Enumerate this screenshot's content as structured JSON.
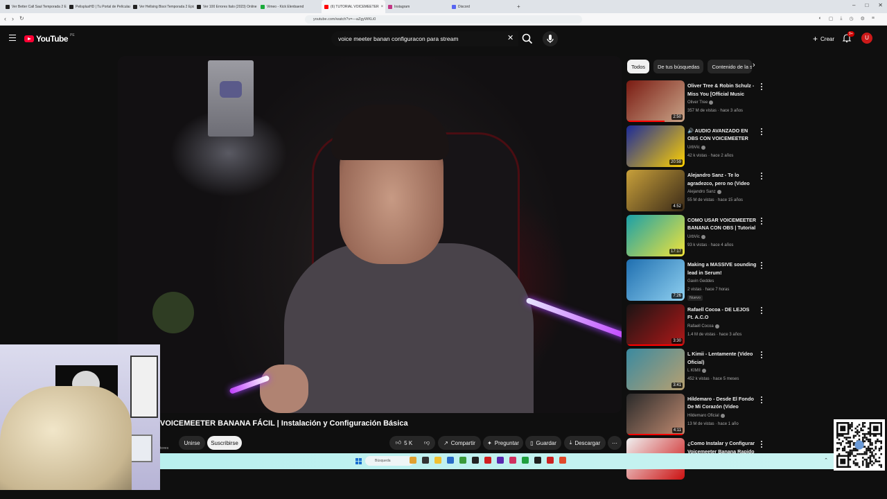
{
  "browser": {
    "tabs": [
      {
        "label": "Ver Better Call Saul Temporada 2 Ep",
        "favicon_color": "#222222",
        "active": false
      },
      {
        "label": "PelisplusHD | Tu Portal de Películas",
        "favicon_color": "#222222",
        "active": false
      },
      {
        "label": "Ver Hellsing Bisoi Temporada 2 Episo",
        "favicon_color": "#222222",
        "active": false
      },
      {
        "label": "Ver 100 Errores Italo (2023) Online",
        "favicon_color": "#222222",
        "active": false
      },
      {
        "label": "Vimeo - Kick Elenbaend",
        "favicon_color": "#1aaa3a",
        "active": false
      },
      {
        "label": "(6) TUTORIAL VOICEMEETER",
        "favicon_color": "#ff0000",
        "active": true
      },
      {
        "label": "Instagram",
        "favicon_color": "#c13584",
        "active": false
      },
      {
        "label": "Discord",
        "favicon_color": "#5865f2",
        "active": false
      }
    ],
    "url": "youtube.com/watch?v=—aZgyWKLi0"
  },
  "masthead": {
    "logo_text": "YouTube",
    "country_code": "PE",
    "search_value": "voice meeter banan configuracon para stream",
    "create_label": "Crear",
    "notification_count": "9+",
    "avatar_letter": "U"
  },
  "video": {
    "title": "VOICEMEETER BANANA FÁCIL | Instalación y Configuración Básica",
    "subscribers_text": "tores",
    "join_label": "Unirse",
    "subscribe_label": "Suscribirse",
    "likes": "5 K",
    "share_label": "Compartir",
    "ask_label": "Preguntar",
    "save_label": "Guardar",
    "download_label": "Descargar"
  },
  "sidebar": {
    "chips": [
      "Todos",
      "De tus búsquedas",
      "Contenido de la se"
    ],
    "recommendations": [
      {
        "title": "Oliver Tree & Robin Schulz - Miss You [Official Music Video]",
        "channel": "Oliver Tree",
        "verified": true,
        "meta": "357 M de vistas · hace 3 años",
        "duration": "2:50",
        "progress": 0.65,
        "thumb_a": "#7a1b12",
        "thumb_b": "#c9a488",
        "badge": ""
      },
      {
        "title": "🔊 AUDIO AVANZADO EN OBS CON VOICEMEETER 2023 | ...",
        "channel": "UrbVic",
        "verified": true,
        "meta": "42 k vistas · hace 2 años",
        "duration": "20:59",
        "progress": 0,
        "thumb_a": "#1b2a9a",
        "thumb_b": "#ffd100",
        "badge": ""
      },
      {
        "title": "Alejandro Sanz - Te lo agradezco, pero no (Video Clip...",
        "channel": "Alejandro Sanz",
        "verified": true,
        "meta": "55 M de vistas · hace 15 años",
        "duration": "4:52",
        "progress": 0,
        "thumb_a": "#c8a03a",
        "thumb_b": "#3a2a18",
        "badge": ""
      },
      {
        "title": "COMO USAR VOICEMEETER BANANA CON OBS | Tutorial | ...",
        "channel": "UrbVic",
        "verified": true,
        "meta": "93 k vistas · hace 4 años",
        "duration": "17:17",
        "progress": 0,
        "thumb_a": "#1aa0a8",
        "thumb_b": "#f2e43a",
        "badge": ""
      },
      {
        "title": "Making a MASSIVE sounding lead in Serum!",
        "channel": "Gavin Geddes",
        "verified": false,
        "meta": "2 vistas · hace 7 horas",
        "duration": "7:26",
        "progress": 0,
        "thumb_a": "#1f6fb0",
        "thumb_b": "#8fd0f0",
        "badge": "Nuevo"
      },
      {
        "title": "Rafaell Cocoa - DE LEJOS Ft. A.C.O",
        "channel": "Rafaell Cocoa",
        "verified": true,
        "meta": "1.4 M de vistas · hace 3 años",
        "duration": "3:30",
        "progress": 1,
        "thumb_a": "#1a1414",
        "thumb_b": "#b01818",
        "badge": ""
      },
      {
        "title": "L Kimii - Lentamente (Video Oficial)",
        "channel": "L KIMII",
        "verified": true,
        "meta": "452 k vistas · hace 5 meses",
        "duration": "3:41",
        "progress": 0,
        "thumb_a": "#3a8aa0",
        "thumb_b": "#b8a070",
        "badge": ""
      },
      {
        "title": "Hildemaro - Desde El Fondo De Mi Corazón (Video Oficial)",
        "channel": "Hildemaro Oficial",
        "verified": true,
        "meta": "13 M de vistas · hace 1 año",
        "duration": "4:11",
        "progress": 1,
        "thumb_a": "#2a2a2a",
        "thumb_b": "#c08a70",
        "badge": ""
      },
      {
        "title": "¿Como Instalar y Configurar Voicemeeter Banana Rapido y...",
        "channel": "",
        "verified": false,
        "meta": "",
        "duration": "",
        "progress": 0,
        "thumb_a": "#f0f0f0",
        "thumb_b": "#cc1111",
        "badge": ""
      }
    ]
  },
  "taskbar": {
    "search_label": "Búsqueda",
    "icon_colors": [
      "#e0a030",
      "#333333",
      "#f0c030",
      "#2a6cc8",
      "#3a9a3a",
      "#222222",
      "#d02020",
      "#5a2ab0",
      "#d03060",
      "#20a040",
      "#202020",
      "#cc2222",
      "#e04a2a"
    ]
  }
}
